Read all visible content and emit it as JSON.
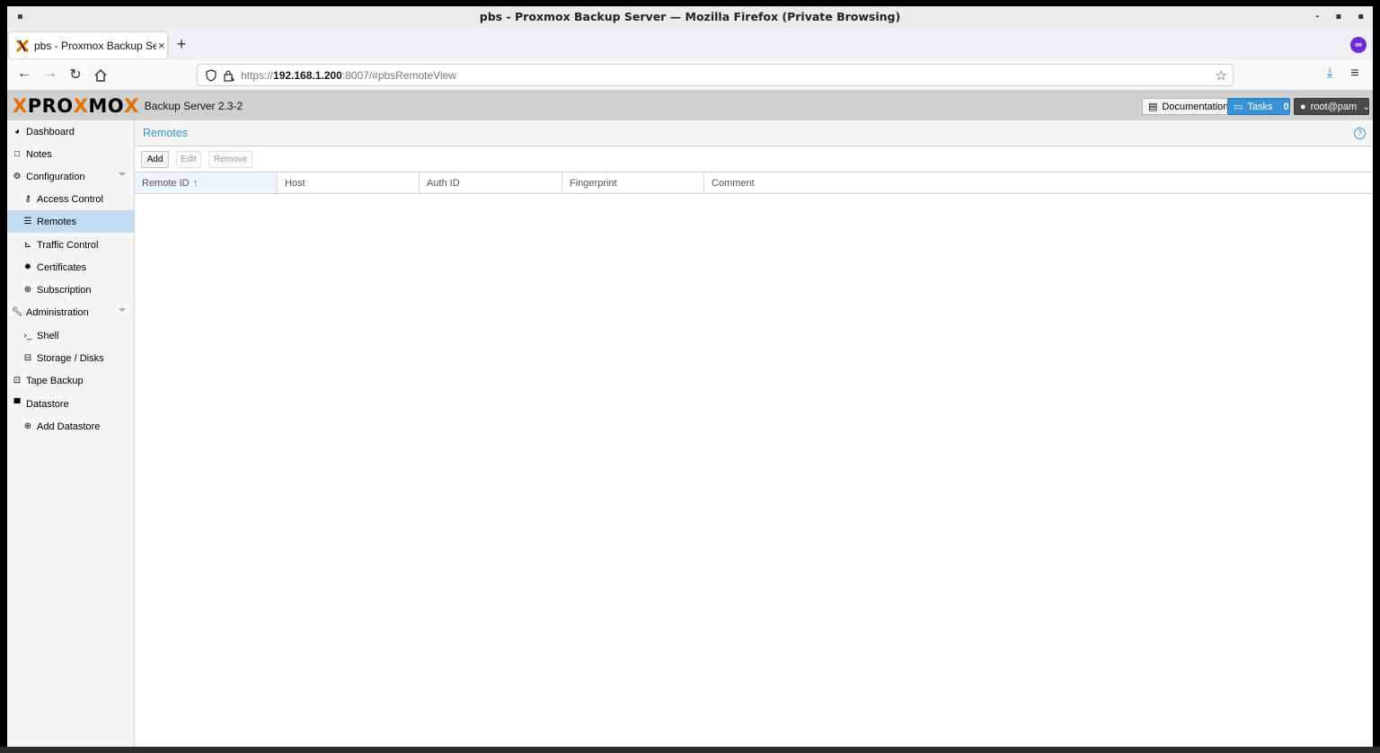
{
  "window": {
    "title": "pbs - Proxmox Backup Server — Mozilla Firefox (Private Browsing)"
  },
  "tab": {
    "label": "pbs - Proxmox Backup Serv",
    "close": "×",
    "new_tab": "+"
  },
  "url": {
    "scheme": "https://",
    "host": "192.168.1.200",
    "rest": ":8007/#pbsRemoteView"
  },
  "header": {
    "logo_pre": "PRO",
    "logo_x": "X",
    "logo_post": "MO",
    "version": "Backup Server 2.3-2",
    "documentation": "Documentation",
    "tasks": "Tasks",
    "tasks_count": "0",
    "user": "root@pam"
  },
  "sidebar": {
    "items": [
      {
        "label": "Dashboard",
        "icon": "dashboard-icon"
      },
      {
        "label": "Notes",
        "icon": "notes-icon"
      },
      {
        "label": "Configuration",
        "icon": "cogs-icon"
      },
      {
        "label": "Access Control",
        "icon": "key-icon"
      },
      {
        "label": "Remotes",
        "icon": "server-icon"
      },
      {
        "label": "Traffic Control",
        "icon": "chart-icon"
      },
      {
        "label": "Certificates",
        "icon": "certificate-icon"
      },
      {
        "label": "Subscription",
        "icon": "support-icon"
      },
      {
        "label": "Administration",
        "icon": "wrench-icon"
      },
      {
        "label": "Shell",
        "icon": "terminal-icon"
      },
      {
        "label": "Storage / Disks",
        "icon": "hdd-icon"
      },
      {
        "label": "Tape Backup",
        "icon": "tape-icon"
      },
      {
        "label": "Datastore",
        "icon": "archive-icon"
      },
      {
        "label": "Add Datastore",
        "icon": "plus-circle-icon"
      }
    ]
  },
  "panel": {
    "title": "Remotes",
    "buttons": {
      "add": "Add",
      "edit": "Edit",
      "remove": "Remove"
    },
    "columns": [
      "Remote ID",
      "Host",
      "Auth ID",
      "Fingerprint",
      "Comment"
    ]
  },
  "colors": {
    "accent": "#3892d4",
    "brand_orange": "#e57000",
    "selected_nav": "#c2ddf2"
  }
}
